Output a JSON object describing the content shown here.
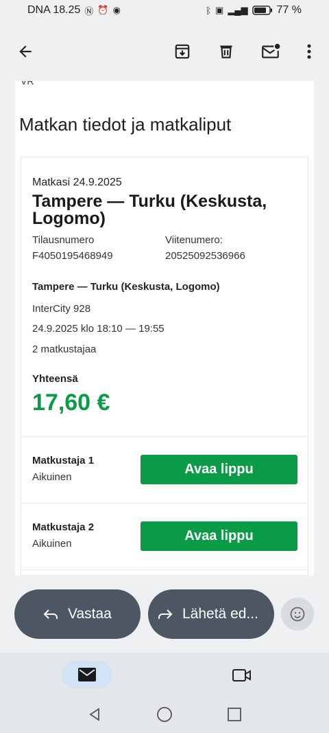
{
  "status_bar": {
    "carrier_time": "DNA 18.25",
    "battery": "77 %"
  },
  "toolbar": {
    "back_icon": "arrow-back-icon",
    "archive_icon": "archive-icon",
    "delete_icon": "trash-icon",
    "mark_unread_icon": "mail-unread-icon",
    "more_icon": "more-vert-icon"
  },
  "email": {
    "cut_text": "VR",
    "section_title": "Matkan tiedot ja matkaliput",
    "trip": {
      "date_line": "Matkasi 24.9.2025",
      "route_title": "Tampere — Turku (Keskusta, Logomo)",
      "order_label": "Tilausnumero",
      "order_number": "F4050195468949",
      "reference_label": "Viitenumero:",
      "reference_number": "20525092536966",
      "route": "Tampere — Turku (Keskusta, Logomo)",
      "train": "InterCity 928",
      "time": "24.9.2025 klo 18:10 — 19:55",
      "passenger_count": "2 matkustajaa",
      "total_label": "Yhteensä",
      "total_value": "17,60 €"
    },
    "passengers": [
      {
        "name": "Matkustaja 1",
        "type": "Aikuinen",
        "button": "Avaa lippu"
      },
      {
        "name": "Matkustaja 2",
        "type": "Aikuinen",
        "button": "Avaa lippu"
      }
    ]
  },
  "actions": {
    "reply": "Vastaa",
    "forward": "Lähetä ed..."
  },
  "colors": {
    "accent_green": "#0a9b46",
    "pill": "#4d5763"
  }
}
